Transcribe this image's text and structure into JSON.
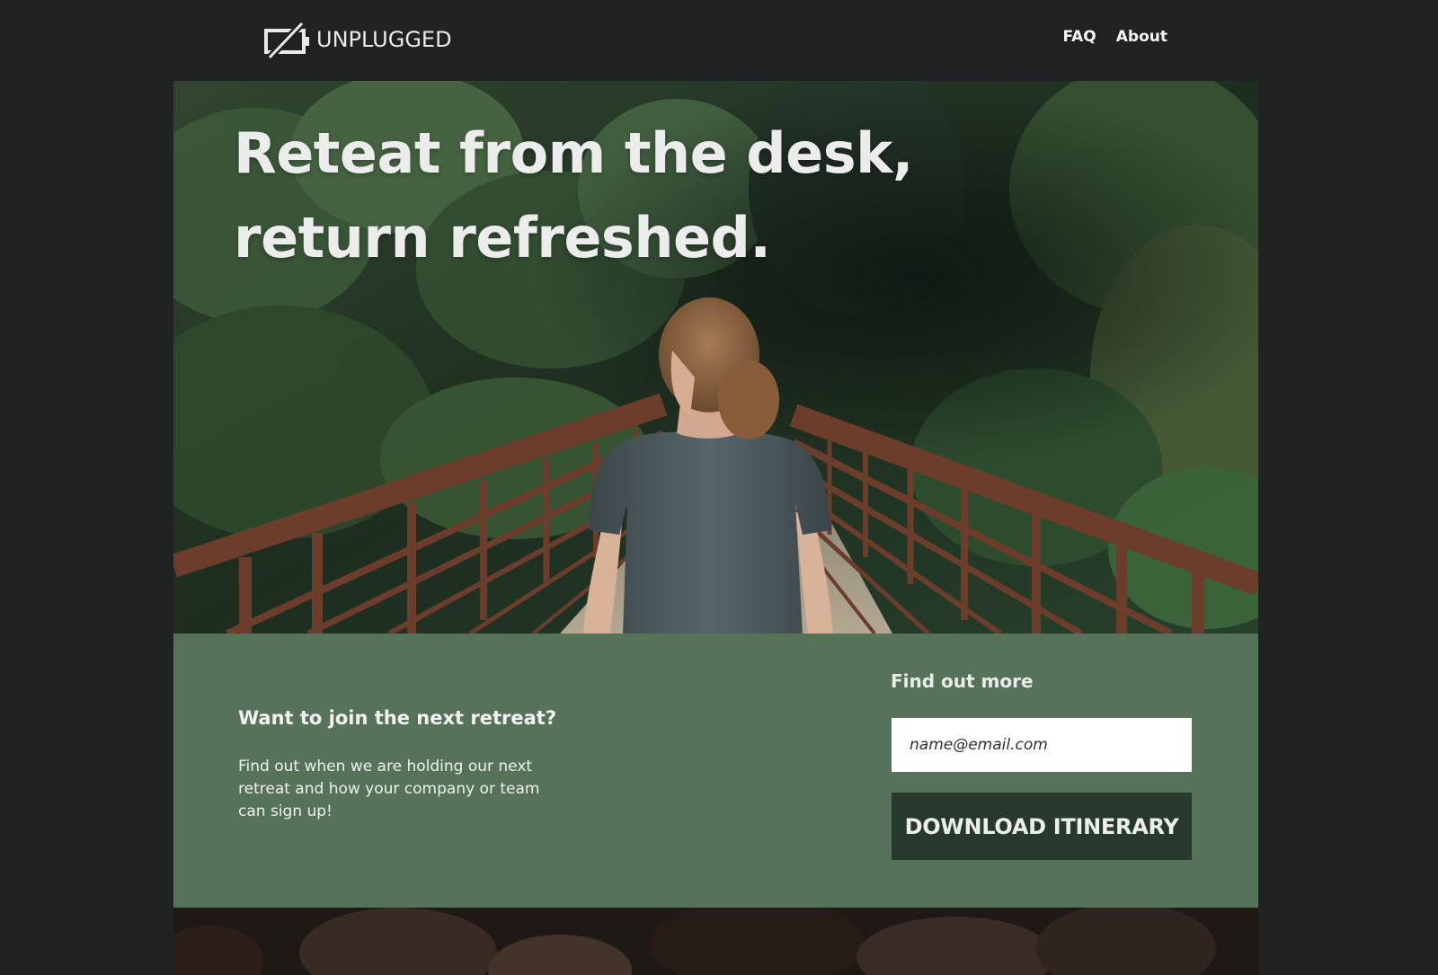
{
  "header": {
    "logo_text": "UNPLUGGED",
    "logo_icon": "unplugged-screen-icon",
    "nav": [
      {
        "label": "FAQ"
      },
      {
        "label": "About"
      }
    ]
  },
  "hero": {
    "title": "Reteat from the desk,\nreturn refreshed.",
    "image": "woman-on-forest-bridge"
  },
  "signup": {
    "heading": "Want to join the next retreat?",
    "text": "Find out when we are holding our next retreat and how your company or team can sign up!"
  },
  "form": {
    "heading": "Find out more",
    "email_placeholder": "name@email.com",
    "email_value": "",
    "button_label": "DOWNLOAD ITINERARY"
  },
  "colors": {
    "page_background": "#202221",
    "band_background": "#56735a",
    "button_background": "#27392d",
    "text_light": "#ececec"
  }
}
